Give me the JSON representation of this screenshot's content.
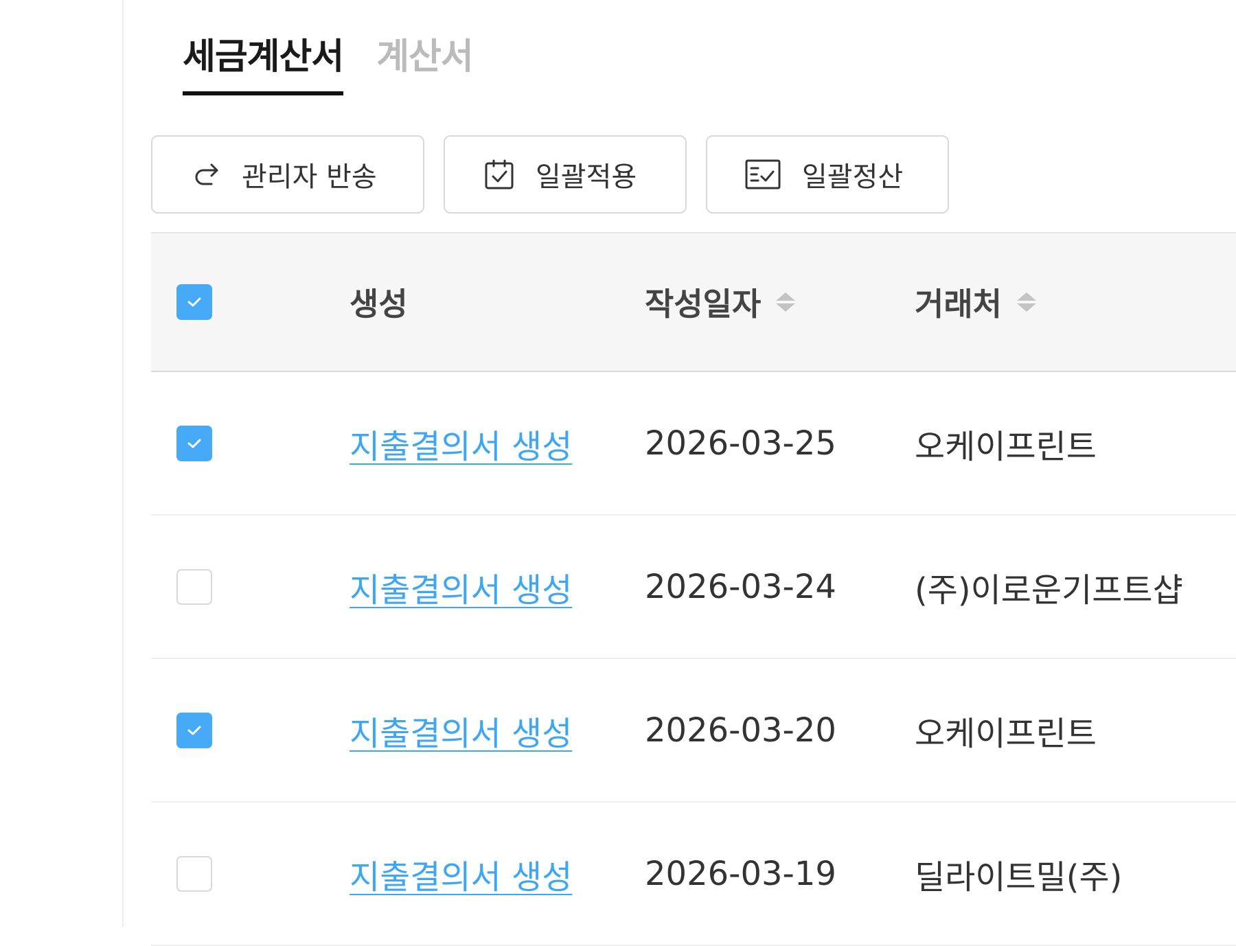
{
  "tabs": [
    {
      "label": "세금계산서",
      "active": true
    },
    {
      "label": "계산서",
      "active": false
    }
  ],
  "toolbar": {
    "return_label": "관리자 반송",
    "bulk_apply_label": "일괄적용",
    "bulk_settle_label": "일괄정산"
  },
  "table": {
    "header": {
      "all_checked": true,
      "create": "생성",
      "date": "작성일자",
      "vendor": "거래처"
    },
    "rows": [
      {
        "checked": true,
        "action": "지출결의서 생성",
        "date": "2026-03-25",
        "vendor": "오케이프린트"
      },
      {
        "checked": false,
        "action": "지출결의서 생성",
        "date": "2026-03-24",
        "vendor": "(주)이로운기프트샵"
      },
      {
        "checked": true,
        "action": "지출결의서 생성",
        "date": "2026-03-20",
        "vendor": "오케이프린트"
      },
      {
        "checked": false,
        "action": "지출결의서 생성",
        "date": "2026-03-19",
        "vendor": "딜라이트밀(주)"
      }
    ]
  },
  "colors": {
    "accent": "#46aaf6",
    "link": "#3ea6f2",
    "tab_active": "#111111",
    "tab_inactive": "#bbbbbb"
  },
  "icons": {
    "return": "share-forward-icon",
    "bulk_apply": "clipboard-check-icon",
    "bulk_settle": "checklist-icon",
    "sort": "sort-icon",
    "check": "check-icon"
  }
}
